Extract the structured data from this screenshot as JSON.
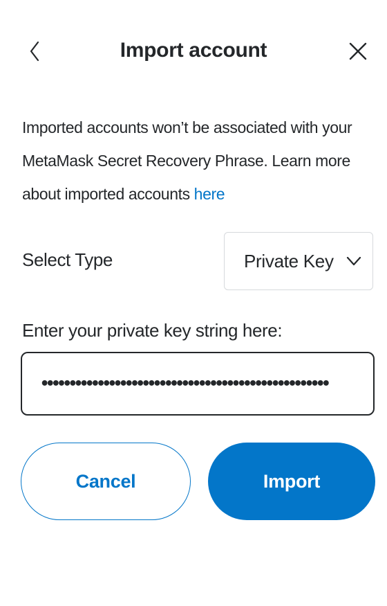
{
  "header": {
    "title": "Import account",
    "back_icon": "chevron-left-icon",
    "close_icon": "close-icon"
  },
  "description": {
    "text": "Imported accounts won’t be associated with your MetaMask Secret Recovery Phrase. Learn more about imported accounts ",
    "link_text": "here"
  },
  "select_type": {
    "label": "Select Type",
    "value": "Private Key",
    "icon": "chevron-down-icon"
  },
  "private_key": {
    "label": "Enter your private key string here:",
    "masked_value": "•••••••••••••••••••••••••••••••••••••••••••••••••••"
  },
  "buttons": {
    "cancel_label": "Cancel",
    "import_label": "Import"
  },
  "colors": {
    "accent": "#0376c9",
    "text": "#24272a",
    "border": "#d6d9dc"
  }
}
